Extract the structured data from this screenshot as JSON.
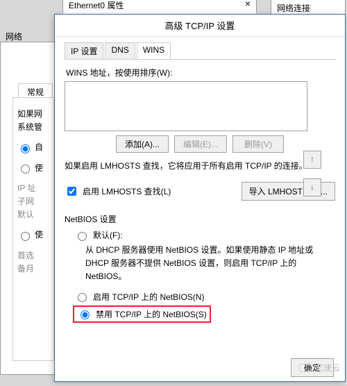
{
  "background": {
    "ethernet_title": "Ethernet0 属性",
    "netconn_title": "网络连接",
    "network_label": "网络",
    "general_tab": "常规",
    "desc_line": "如果网\n系统管",
    "auto_radio": "自",
    "use_radio": "使",
    "ip_label": "IP 址",
    "subnet_label": "子网",
    "gateway_label": "默认",
    "use2_radio": "使",
    "pref_label": "首选",
    "alt_label": "备月"
  },
  "dialog": {
    "title": "高级 TCP/IP 设置",
    "tabs": {
      "ip": "IP 设置",
      "dns": "DNS",
      "wins": "WINS"
    },
    "wins_addr_label": "WINS 地址，按使用排序(W):",
    "buttons": {
      "add": "添加(A)...",
      "edit": "编辑(E)...",
      "remove": "删除(V)"
    },
    "lmhosts_note": "如果启用 LMHOSTS 查找，它将应用于所有启用 TCP/IP 的连接。",
    "enable_lmhosts": "启用 LMHOSTS 查找(L)",
    "import_lmhosts": "导入 LMHOSTS(M)...",
    "netbios_group": "NetBIOS 设置",
    "radio_default": "默认(F):",
    "default_desc": "从 DHCP 服务器使用 NetBIOS 设置。如果使用静态 IP 地址或 DHCP 服务器不提供 NetBIOS 设置，则启用 TCP/IP 上的 NetBIOS。",
    "radio_enable": "启用 TCP/IP 上的 NetBIOS(N)",
    "radio_disable": "禁用 TCP/IP 上的 NetBIOS(S)",
    "ok": "确定"
  },
  "watermark": "亿速云"
}
